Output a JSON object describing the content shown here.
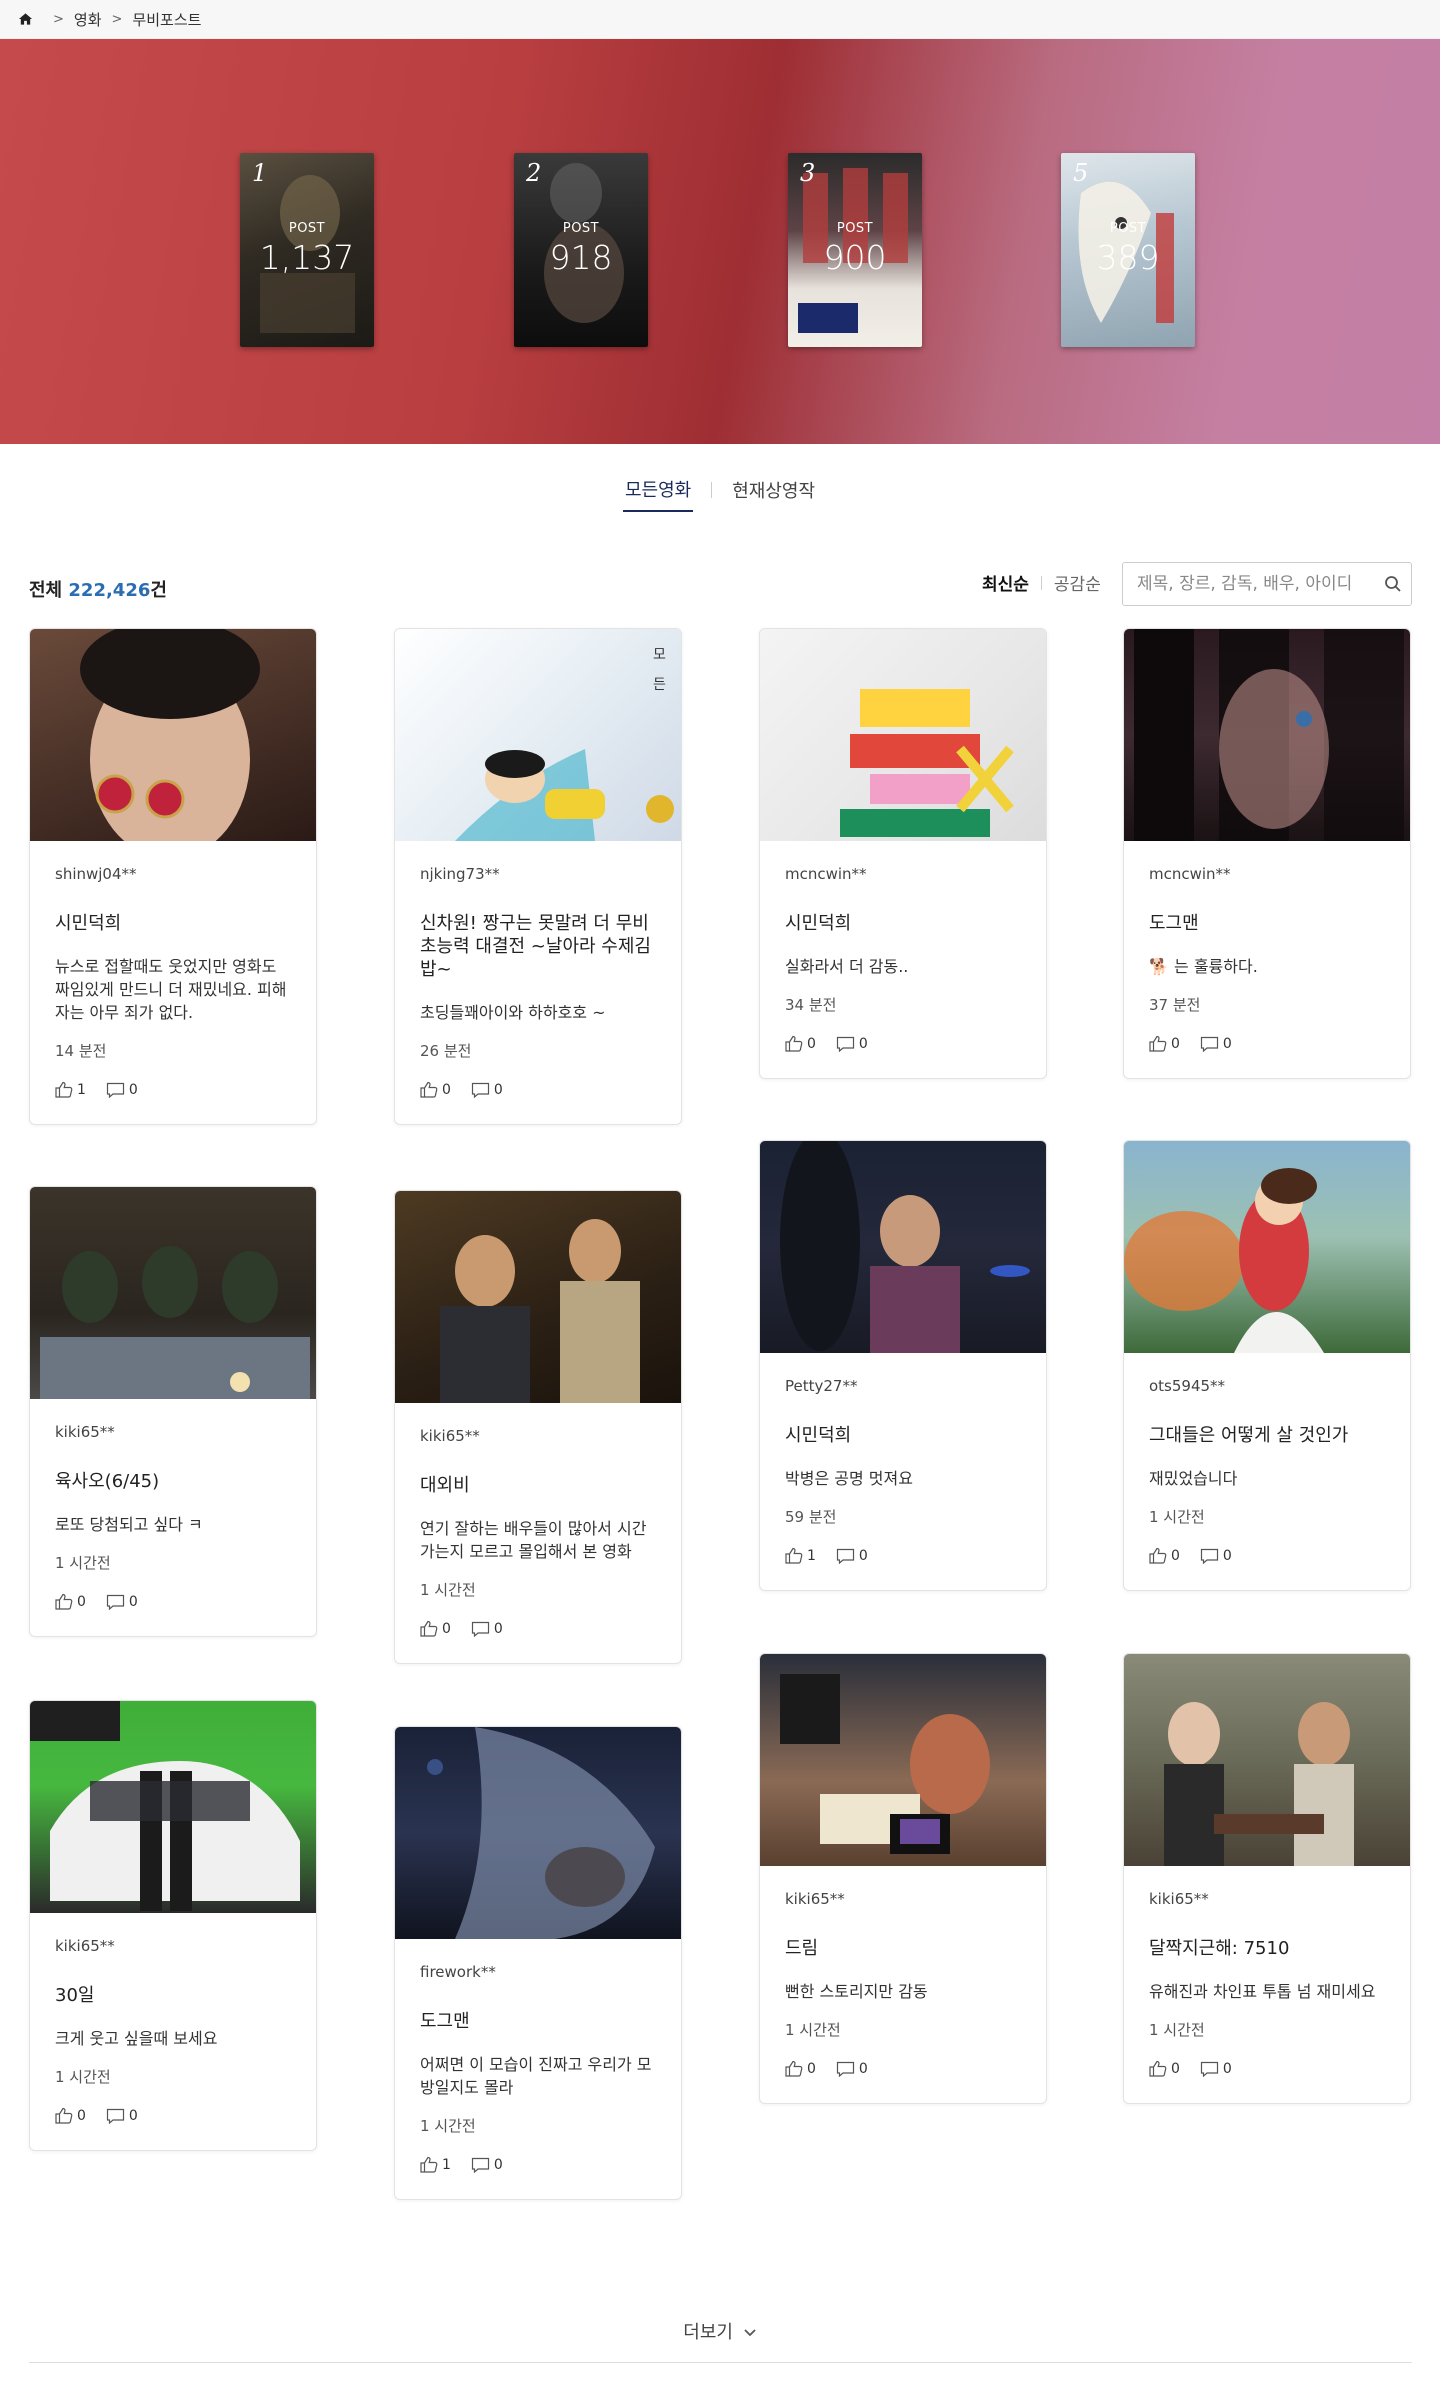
{
  "breadcrumb": {
    "items": [
      "영화",
      "무비포스트"
    ],
    "separator": ">"
  },
  "hero": {
    "cards": [
      {
        "rank": "1",
        "label": "POST",
        "count": "1,137"
      },
      {
        "rank": "2",
        "label": "POST",
        "count": "918"
      },
      {
        "rank": "3",
        "label": "POST",
        "count": "900"
      },
      {
        "rank": "5",
        "label": "POST",
        "count": "389"
      }
    ]
  },
  "tabs": [
    {
      "label": "모든영화",
      "active": true
    },
    {
      "label": "현재상영작",
      "active": false
    }
  ],
  "summary": {
    "prefix": "전체 ",
    "count": "222,426",
    "suffix": "건"
  },
  "sort": [
    {
      "label": "최신순",
      "active": true
    },
    {
      "label": "공감순",
      "active": false
    }
  ],
  "search": {
    "placeholder": "제목, 장르, 감독, 배우, 아이디"
  },
  "posts": [
    {
      "user": "shinwj04**",
      "title": "시민덕희",
      "text": "뉴스로 접할때도 웃었지만 영화도 짜임있게 만드니 더 재밌네요. 피해자는 아무 죄가 없다.",
      "time": "14 분전",
      "likes": "1",
      "comments": "0"
    },
    {
      "user": "njking73**",
      "title": "신차원! 짱구는 못말려 더 무비 초능력 대결전 ~날아라 수제김밥~",
      "text": "초딩들꽤아이와 하하호호 ~",
      "time": "26 분전",
      "likes": "0",
      "comments": "0"
    },
    {
      "user": "mcncwin**",
      "title": "시민덕희",
      "text": "실화라서 더 감동..",
      "time": "34 분전",
      "likes": "0",
      "comments": "0"
    },
    {
      "user": "mcncwin**",
      "title": "도그맨",
      "text": "🐕 는 훌륭하다.",
      "time": "37 분전",
      "likes": "0",
      "comments": "0"
    },
    {
      "user": "kiki65**",
      "title": "육사오(6/45)",
      "text": "로또 당첨되고 싶다 ㅋ",
      "time": "1 시간전",
      "likes": "0",
      "comments": "0"
    },
    {
      "user": "kiki65**",
      "title": "대외비",
      "text": "연기 잘하는 배우들이 많아서 시간 가는지 모르고 몰입해서 본 영화",
      "time": "1 시간전",
      "likes": "0",
      "comments": "0"
    },
    {
      "user": "Petty27**",
      "title": "시민덕희",
      "text": "박병은 공명 멋져요",
      "time": "59 분전",
      "likes": "1",
      "comments": "0"
    },
    {
      "user": "ots5945**",
      "title": "그대들은 어떻게 살 것인가",
      "text": "재밌었습니다",
      "time": "1 시간전",
      "likes": "0",
      "comments": "0"
    },
    {
      "user": "kiki65**",
      "title": "30일",
      "text": "크게 웃고 싶을때 보세요",
      "time": "1 시간전",
      "likes": "0",
      "comments": "0"
    },
    {
      "user": "firework**",
      "title": "도그맨",
      "text": "어쩌면 이 모습이 진짜고 우리가 모방일지도 몰라",
      "time": "1 시간전",
      "likes": "1",
      "comments": "0"
    },
    {
      "user": "kiki65**",
      "title": "드림",
      "text": "뻔한 스토리지만 감동",
      "time": "1 시간전",
      "likes": "0",
      "comments": "0"
    },
    {
      "user": "kiki65**",
      "title": "달짝지근해: 7510",
      "text": "유해진과 차인표 투톱 넘 재미세요",
      "time": "1 시간전",
      "likes": "0",
      "comments": "0"
    }
  ],
  "more": {
    "label": "더보기"
  }
}
